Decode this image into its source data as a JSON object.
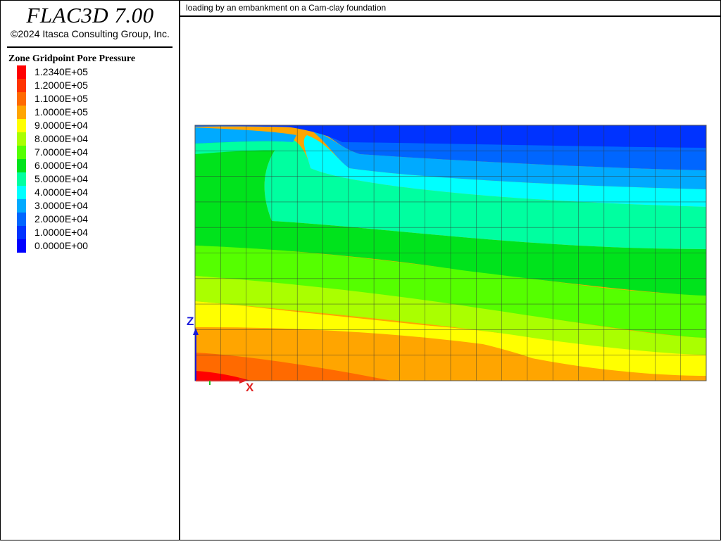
{
  "app": {
    "title": "FLAC3D 7.00",
    "copyright": "©2024 Itasca Consulting Group, Inc."
  },
  "plot": {
    "title": "loading by an embankment on a Cam-clay foundation"
  },
  "legend": {
    "title": "Zone Gridpoint Pore Pressure",
    "items": [
      {
        "label": "1.2340E+05",
        "color": "#ff0000"
      },
      {
        "label": "1.2000E+05",
        "color": "#ff3300"
      },
      {
        "label": "1.1000E+05",
        "color": "#ff6a00"
      },
      {
        "label": "1.0000E+05",
        "color": "#ffa500"
      },
      {
        "label": "9.0000E+04",
        "color": "#ffff00"
      },
      {
        "label": "8.0000E+04",
        "color": "#aaff00"
      },
      {
        "label": "7.0000E+04",
        "color": "#55ff00"
      },
      {
        "label": "6.0000E+04",
        "color": "#00e31c"
      },
      {
        "label": "5.0000E+04",
        "color": "#00ffa0"
      },
      {
        "label": "4.0000E+04",
        "color": "#00ffff"
      },
      {
        "label": "3.0000E+04",
        "color": "#00aaff"
      },
      {
        "label": "2.0000E+04",
        "color": "#0066ff"
      },
      {
        "label": "1.0000E+04",
        "color": "#0033ff"
      },
      {
        "label": "0.0000E+00",
        "color": "#0000ff"
      }
    ]
  },
  "axes": {
    "z_label": "Z",
    "x_label": "X",
    "z_color": "#1a1adb",
    "x_color": "#e02020",
    "y_color": "#20c020"
  },
  "mesh": {
    "columns": 20,
    "rows": 10
  }
}
